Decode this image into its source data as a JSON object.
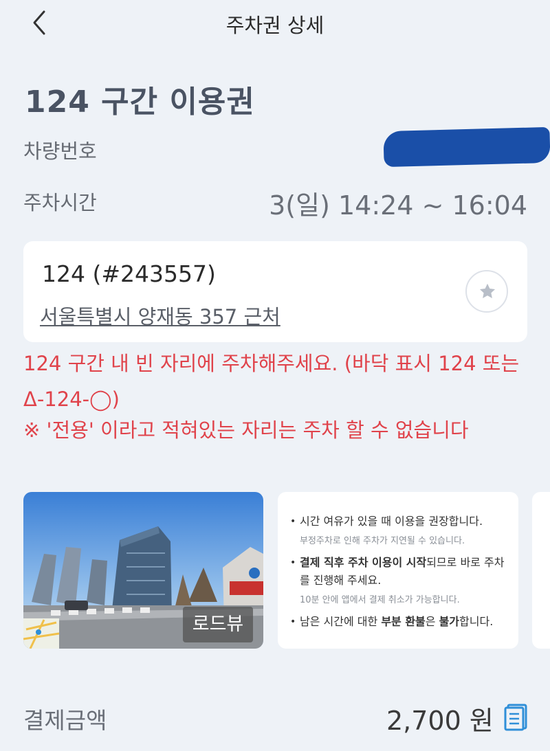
{
  "header": {
    "title": "주차권 상세"
  },
  "ticket": {
    "title": "124 구간 이용권",
    "vehicle_label": "차량번호",
    "time_label": "주차시간",
    "time_value": "3(일) 14:24 ~ 16:04"
  },
  "zone": {
    "name": "124 (#243557)",
    "address": "서울특별시 양재동 357 근처"
  },
  "notices": {
    "main": "124 구간 내 빈 자리에 주차해주세요. (바닥 표시 124 또는 Δ-124-◯)",
    "exclusive": "※ '전용' 이라고 적혀있는 자리는 주차 할 수 없습니다"
  },
  "roadview": {
    "label": "로드뷰"
  },
  "info": {
    "item1": "시간 여유가 있을 때 이용을 권장합니다.",
    "item1_sub": "부정주차로 인해 주차가 지연될 수 있습니다.",
    "item2_bold": "결제 직후 주차 이용이 시작",
    "item2_rest": "되므로 바로 주차를 진행해 주세요.",
    "item2_sub": "10분 안에 앱에서 결제 취소가 가능합니다.",
    "item3_pre": "남은 시간에 대한 ",
    "item3_bold1": "부분 환불",
    "item3_mid": "은 ",
    "item3_bold2": "불가",
    "item3_post": "합니다."
  },
  "payment": {
    "label": "결제금액",
    "amount": "2,700 원"
  },
  "colors": {
    "background": "#eef2f7",
    "warning": "#e0434b",
    "accent": "#2f8fd8"
  },
  "icons": {
    "back": "chevron-left-icon",
    "favorite": "star-icon",
    "receipt": "receipt-icon"
  }
}
